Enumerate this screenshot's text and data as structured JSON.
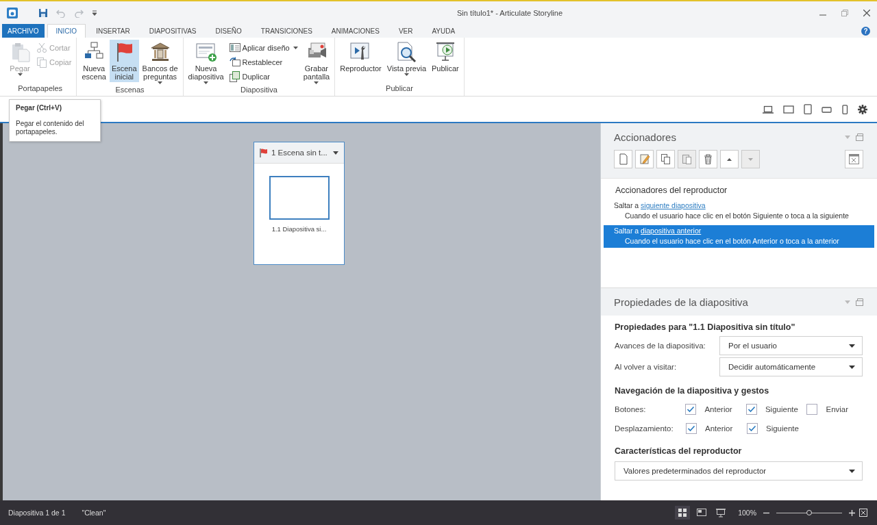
{
  "window": {
    "title": "Sin título1* -  Articulate Storyline"
  },
  "quick_access": [
    {
      "kind": "save"
    },
    {
      "kind": "undo",
      "disabled": true
    },
    {
      "kind": "redo",
      "disabled": true
    },
    {
      "kind": "customize"
    }
  ],
  "menu_tabs": [
    {
      "label": "ARCHIVO",
      "kind": "backstage",
      "selected": false
    },
    {
      "label": "INICIO",
      "kind": "tab",
      "selected": true
    },
    {
      "label": "INSERTAR",
      "kind": "tab",
      "selected": false
    },
    {
      "label": "DIAPOSITIVAS",
      "kind": "tab",
      "selected": false
    },
    {
      "label": "DISEÑO",
      "kind": "tab",
      "selected": false
    },
    {
      "label": "TRANSICIONES",
      "kind": "tab",
      "selected": false
    },
    {
      "label": "ANIMACIONES",
      "kind": "tab",
      "selected": false
    },
    {
      "label": "VER",
      "kind": "tab",
      "selected": false
    },
    {
      "label": "AYUDA",
      "kind": "tab",
      "selected": false
    }
  ],
  "help": "?",
  "ribbon": {
    "groups": [
      {
        "label": "Portapapeles",
        "items": [
          {
            "label": "Pegar",
            "kind": "large",
            "dropdown": true,
            "disabled": true,
            "selected": false
          },
          {
            "label": "Cortar",
            "kind": "small",
            "disabled": true
          },
          {
            "label": "Copiar",
            "kind": "small",
            "disabled": true
          }
        ]
      },
      {
        "label": "Escenas",
        "items": [
          {
            "label": "Nueva\nescena",
            "kind": "large",
            "disabled": false,
            "selected": false
          },
          {
            "label": "Escena\ninicial",
            "kind": "large",
            "disabled": false,
            "selected": true
          },
          {
            "label": "Bancos de\npreguntas",
            "kind": "large",
            "dropdown": true,
            "disabled": false,
            "selected": false
          }
        ]
      },
      {
        "label": "Diapositiva",
        "items": [
          {
            "label": "Nueva\ndiapositiva",
            "kind": "large",
            "dropdown": true,
            "disabled": false,
            "selected": false
          },
          {
            "label": "Aplicar diseño",
            "kind": "small",
            "dropdown": true,
            "disabled": false
          },
          {
            "label": "Restablecer",
            "kind": "small",
            "disabled": false
          },
          {
            "label": "Duplicar",
            "kind": "small",
            "disabled": false
          },
          {
            "label": "Grabar\npantalla",
            "kind": "large",
            "dropdown": true,
            "disabled": false,
            "selected": false
          }
        ]
      },
      {
        "label": "Publicar",
        "items": [
          {
            "label": "Reproductor",
            "kind": "large",
            "disabled": false,
            "selected": false
          },
          {
            "label": "Vista previa",
            "kind": "large",
            "dropdown": true,
            "disabled": false,
            "selected": false
          },
          {
            "label": "Publicar",
            "kind": "large",
            "disabled": false,
            "selected": false
          }
        ]
      }
    ]
  },
  "tooltip": {
    "title": "Pegar (Ctrl+V)",
    "text": "Pegar el contenido del portapapeles."
  },
  "scene": {
    "title": "1 Escena sin t...",
    "slides": [
      {
        "label": "1.1 Diapositiva si...",
        "selected": true
      }
    ]
  },
  "triggers_panel": {
    "title": "Accionadores",
    "toolbar": [
      {
        "kind": "new",
        "disabled": false
      },
      {
        "kind": "edit",
        "disabled": false
      },
      {
        "kind": "copy",
        "disabled": false
      },
      {
        "kind": "paste",
        "disabled": true
      },
      {
        "kind": "delete",
        "disabled": false
      },
      {
        "kind": "up",
        "disabled": false
      },
      {
        "kind": "down",
        "disabled": true
      },
      {
        "kind": "variables",
        "disabled": false
      }
    ],
    "section": "Accionadores del reproductor",
    "triggers": [
      {
        "action": "Saltar a",
        "link": "siguiente diapositiva",
        "condition": "Cuando el usuario hace clic en el botón Siguiente o toca a la siguiente",
        "selected": false
      },
      {
        "action": "Saltar a",
        "link": "diapositiva anterior",
        "condition": "Cuando el usuario hace clic en el botón Anterior o toca a la anterior",
        "selected": true
      }
    ]
  },
  "properties_panel": {
    "title": "Propiedades de la diapositiva",
    "heading": "Propiedades para \"1.1 Diapositiva sin título\"",
    "fields": [
      {
        "label": "Avances de la diapositiva:",
        "value": "Por el usuario"
      },
      {
        "label": "Al volver a visitar:",
        "value": "Decidir automáticamente"
      }
    ],
    "navigation": {
      "heading": "Navegación de la diapositiva y gestos",
      "rows": [
        {
          "label": "Botones:",
          "options": [
            {
              "label": "Anterior",
              "checked": true
            },
            {
              "label": "Siguiente",
              "checked": true
            },
            {
              "label": "Enviar",
              "checked": false
            }
          ]
        },
        {
          "label": "Desplazamiento:",
          "options": [
            {
              "label": "Anterior",
              "checked": true
            },
            {
              "label": "Siguiente",
              "checked": true
            }
          ]
        }
      ]
    },
    "player": {
      "heading": "Características del reproductor",
      "value": "Valores predeterminados del reproductor"
    }
  },
  "status_bar": {
    "slide_count": "Diapositiva 1 de 1",
    "theme": "\"Clean\"",
    "views": [
      {
        "kind": "grid",
        "selected": true
      },
      {
        "kind": "slide",
        "selected": false
      },
      {
        "kind": "present",
        "selected": false
      }
    ],
    "zoom": {
      "reading": "100%",
      "level": 0.5
    }
  }
}
